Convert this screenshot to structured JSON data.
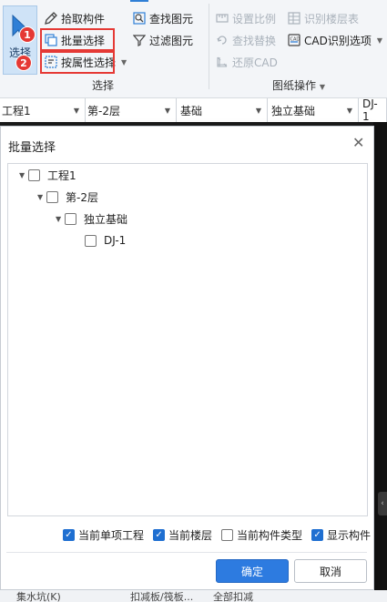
{
  "ribbon": {
    "select_label": "选择",
    "pick_component": "拾取构件",
    "batch_select": "批量选择",
    "select_by_attr": "按属性选择",
    "find_element": "查找图元",
    "filter_element": "过滤图元",
    "select_group": "选择",
    "set_scale": "设置比例",
    "identify_floor_table": "识别楼层表",
    "find_replace": "查找替换",
    "cad_identify_options": "CAD识别选项",
    "restore_cad": "还原CAD",
    "drawing_ops_group": "图纸操作",
    "markers": [
      "1",
      "2"
    ]
  },
  "filterbar": {
    "cells": [
      "工程1",
      "第-2层",
      "基础",
      "独立基础",
      "DJ-1"
    ]
  },
  "dialog": {
    "title": "批量选择",
    "tree": [
      {
        "label": "工程1"
      },
      {
        "label": "第-2层"
      },
      {
        "label": "独立基础"
      },
      {
        "label": "DJ-1"
      }
    ],
    "options": [
      {
        "label": "当前单项工程",
        "checked": true
      },
      {
        "label": "当前楼层",
        "checked": true
      },
      {
        "label": "当前构件类型",
        "checked": false
      },
      {
        "label": "显示构件",
        "checked": true
      }
    ],
    "ok": "确定",
    "cancel": "取消"
  },
  "bottom": {
    "items": [
      "集水坑(K)",
      "扣减板/筏板...",
      "全部扣减"
    ]
  },
  "colors": {
    "accent": "#2d7be0",
    "highlight": "#e53935"
  }
}
